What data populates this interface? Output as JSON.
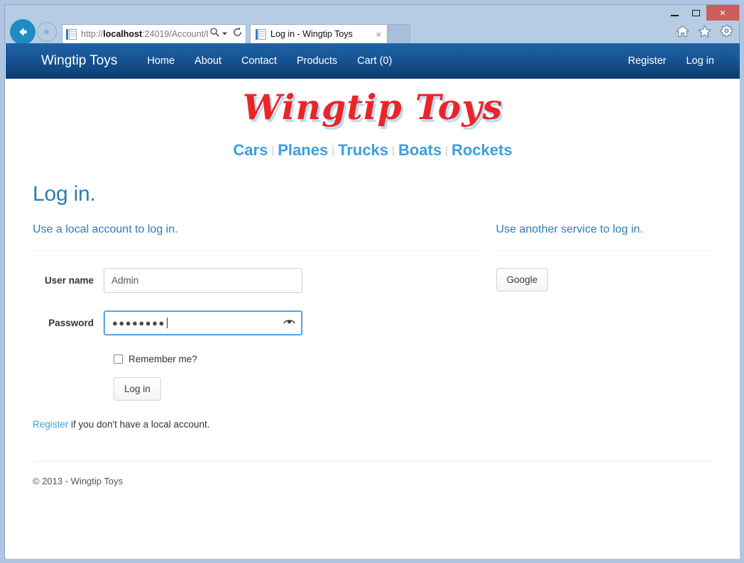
{
  "browser": {
    "back_icon": "back-arrow-icon",
    "forward_icon": "forward-arrow-icon",
    "url": "http://localhost:24019/Account/L",
    "url_bold_part": "localhost",
    "url_prefix": "http://",
    "url_suffix": ":24019/Account/L",
    "search_icon": "search-icon",
    "dropdown_icon": "chevron-down-icon",
    "refresh_icon": "refresh-icon",
    "tab_title": "Log in - Wingtip Toys",
    "tab_close_label": "×",
    "home_icon": "home-icon",
    "favorites_icon": "star-icon",
    "settings_icon": "gear-icon",
    "minimize_label": "minimize",
    "maximize_label": "maximize",
    "close_label": "×"
  },
  "navbar": {
    "brand": "Wingtip Toys",
    "left_links": [
      {
        "label": "Home"
      },
      {
        "label": "About"
      },
      {
        "label": "Contact"
      },
      {
        "label": "Products"
      },
      {
        "label": "Cart (0)"
      }
    ],
    "right_links": [
      {
        "label": "Register"
      },
      {
        "label": "Log in"
      }
    ]
  },
  "logo": {
    "text": "Wingtip Toys",
    "color": "#e8262a",
    "shadow_color": "#b9dced"
  },
  "categories": {
    "separator": "|",
    "items": [
      {
        "label": "Cars"
      },
      {
        "label": "Planes"
      },
      {
        "label": "Trucks"
      },
      {
        "label": "Boats"
      },
      {
        "label": "Rockets"
      }
    ]
  },
  "page": {
    "title": "Log in.",
    "accent_color": "#2b7cb4"
  },
  "local_login": {
    "section_title": "Use a local account to log in.",
    "username_label": "User name",
    "username_value": "Admin",
    "username_placeholder": "",
    "password_label": "Password",
    "password_value": "●●●●●●●●",
    "password_reveal_icon": "eye-reveal-icon",
    "remember_label": "Remember me?",
    "remember_checked": false,
    "submit_label": "Log in",
    "register_link": "Register",
    "register_text": " if you don't have a local account."
  },
  "external_login": {
    "section_title": "Use another service to log in.",
    "providers": [
      {
        "label": "Google"
      }
    ]
  },
  "footer": {
    "text": "© 2013 - Wingtip Toys"
  }
}
